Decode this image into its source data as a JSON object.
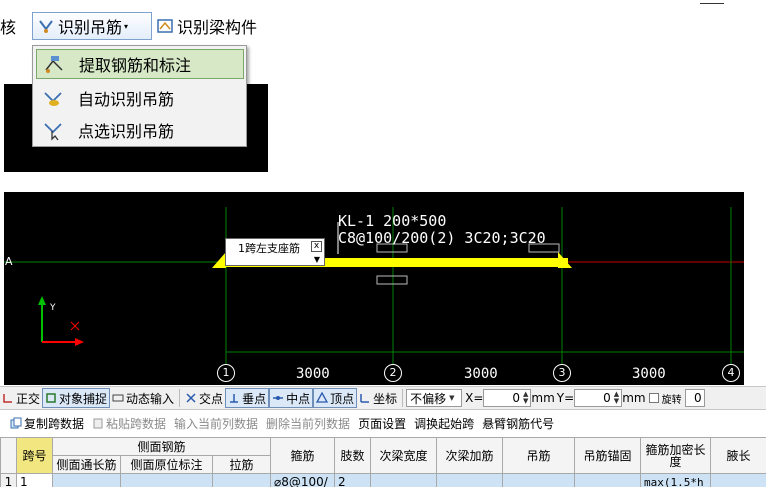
{
  "toolbar": {
    "audit_label": "核",
    "hanger_label": "识别吊筋",
    "beam_label": "识别梁构件",
    "caret": "▾"
  },
  "dropdown": {
    "items": [
      {
        "label": "提取钢筋和标注",
        "icon": "extract-rebar-icon"
      },
      {
        "label": "自动识别吊筋",
        "icon": "auto-recognize-icon"
      },
      {
        "label": "点选识别吊筋",
        "icon": "point-select-icon"
      }
    ]
  },
  "cad": {
    "beam_name": "KL-1 200*500",
    "beam_rebar": "C8@100/200(2) 3C20;3C20",
    "inplace_edit": {
      "text": "1跨左支座筋",
      "close": "x",
      "arrow": "▼"
    },
    "axis_left": "A",
    "axes": [
      "1",
      "2",
      "3",
      "4"
    ],
    "dimensions": [
      "3000",
      "3000",
      "3000"
    ],
    "colors": {
      "beam": "#ffff00",
      "grid": "#008000",
      "axis_red": "#ff0000",
      "background": "#000000"
    }
  },
  "snapbar": {
    "ortho": "正交",
    "object_snap": "对象捕捉",
    "dynamic_input": "动态输入",
    "intersection": "交点",
    "perpendicular": "垂点",
    "midpoint": "中点",
    "vertex": "顶点",
    "coordinate": "坐标",
    "offset_mode": "不偏移",
    "x_label": "X=",
    "x_value": "0",
    "mm1": "mm",
    "y_label": "Y=",
    "y_value": "0",
    "mm2": "mm",
    "rotate": "旋转",
    "rotate_value": "0"
  },
  "actbar": {
    "copy_span": "复制跨数据",
    "paste_span": "粘贴跨数据",
    "input_column": "输入当前列数据",
    "delete_column": "删除当前列数据",
    "page_setup": "页面设置",
    "swap_start": "调换起始跨",
    "cantilever": "悬臂钢筋代号"
  },
  "grid": {
    "headers": {
      "span_no": "跨号",
      "side_group": "侧面钢筋",
      "side_through": "侧面通长筋",
      "side_original": "侧面原位标注",
      "tie_bar": "拉筋",
      "stirrup": "箍筋",
      "legs": "肢数",
      "sec_beam_width": "次梁宽度",
      "sec_beam_add": "次梁加筋",
      "hanger": "吊筋",
      "hanger_anchor": "吊筋锚固",
      "dense_length": "箍筋加密长度",
      "haunch": "腋长"
    },
    "rows": [
      {
        "row_num": "1",
        "span_no": "1",
        "side_through": "",
        "side_original": "",
        "tie_bar": "",
        "stirrup": "⌀8@100/",
        "legs": "2",
        "sec_beam_width": "",
        "sec_beam_add": "",
        "hanger": "",
        "hanger_anchor": "",
        "dense_length": "max(1.5*h",
        "haunch": ""
      }
    ]
  }
}
